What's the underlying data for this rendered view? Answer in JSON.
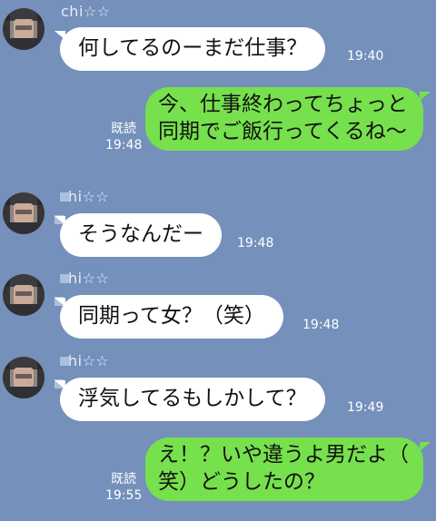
{
  "messages": [
    {
      "sender": "chi☆☆",
      "text": "何してるのーまだ仕事？",
      "time": "19:40"
    },
    {
      "text": "今、仕事終わってちょっと\n同期でご飯行ってくるね〜",
      "read": "既読",
      "time": "19:48"
    },
    {
      "sender": "hi☆☆",
      "text": "そうなんだー",
      "time": "19:48"
    },
    {
      "sender": "hi☆☆",
      "text": "同期って女？（笑）",
      "time": "19:48"
    },
    {
      "sender": "hi☆☆",
      "text": "浮気してるもしかして？",
      "time": "19:49"
    },
    {
      "text": "え！？いや違うよ男だよ（\n笑）どうしたの？",
      "read": "既読",
      "time": "19:55"
    }
  ],
  "colors": {
    "background": "#7490bb",
    "incoming": "#ffffff",
    "outgoing": "#77e04d"
  }
}
